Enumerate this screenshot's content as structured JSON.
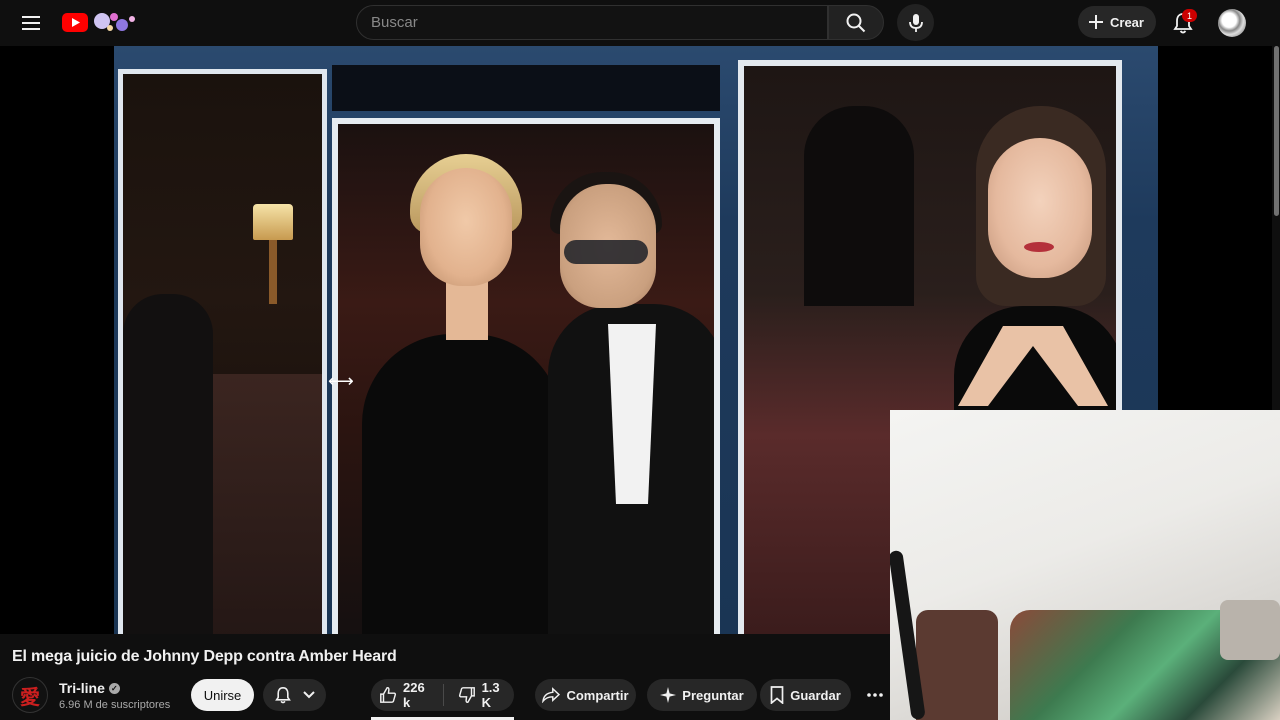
{
  "header": {
    "search_placeholder": "Buscar",
    "create_label": "Crear",
    "notification_count": "1"
  },
  "video": {
    "title": "El mega juicio de Johnny Depp contra Amber Heard"
  },
  "channel": {
    "name": "Tri-line",
    "subscribers": "6.96 M de suscriptores",
    "avatar_glyph": "愛"
  },
  "actions": {
    "join_label": "Unirse",
    "likes": "226 k",
    "dislikes": "1.3 K",
    "share_label": "Compartir",
    "ask_label": "Preguntar",
    "save_label": "Guardar"
  },
  "colors": {
    "background": "#0f0f0f",
    "brand_red": "#ff0000",
    "badge_red": "#cc0000"
  },
  "icons": [
    "menu-icon",
    "youtube-logo-icon",
    "search-icon",
    "mic-icon",
    "plus-icon",
    "bell-icon",
    "chevron-down-icon",
    "thumbs-up-icon",
    "thumbs-down-icon",
    "share-icon",
    "sparkle-icon",
    "bookmark-icon",
    "more-icon",
    "verified-icon",
    "resize-cursor-icon"
  ]
}
